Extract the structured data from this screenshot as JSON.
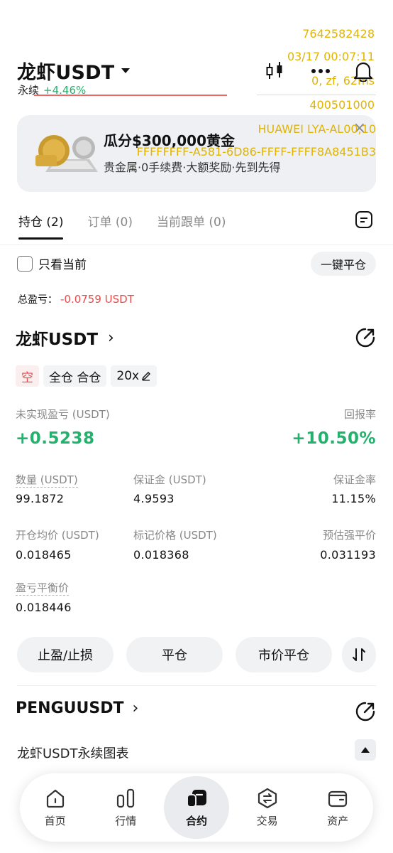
{
  "debug": {
    "line1": "7642582428",
    "line2": "03/17 00:07:11",
    "line3": "0, zf, 62ms",
    "line4": "400501000",
    "line5": "HUAWEI LYA-AL00,10",
    "line6": "FFFFFFFF-A581-6D86-FFFF-FFFF8A8451B3"
  },
  "header": {
    "title": "龙虾USDT",
    "subtitle_prefix": "永续",
    "change": "+4.46%",
    "icons": [
      "candlestick-icon",
      "more-icon",
      "bell-icon"
    ]
  },
  "banner": {
    "title": "瓜分$300,000黄金",
    "subtitle": "贵金属·0手续费·大额奖励·先到先得",
    "close": "×"
  },
  "tabs": [
    {
      "label": "持仓 (2)",
      "active": true
    },
    {
      "label": "订单 (0)",
      "active": false
    },
    {
      "label": "当前跟单 (0)",
      "active": false
    }
  ],
  "filter": {
    "checkbox_label": "只看当前",
    "close_all": "一键平仓"
  },
  "total_pnl": {
    "label": "总盈亏：",
    "value": "-0.0759 USDT"
  },
  "position": {
    "symbol": "龙虾USDT",
    "tags": [
      "空",
      "全仓 合仓",
      "20x"
    ],
    "unrealized_label": "未实现盈亏 (USDT)",
    "unrealized_value": "+0.5238",
    "roe_label": "回报率",
    "roe_value": "+10.50%",
    "qty_label": "数量 (USDT)",
    "qty_value": "99.1872",
    "margin_label": "保证金 (USDT)",
    "margin_value": "4.9593",
    "margin_ratio_label": "保证金率",
    "margin_ratio_value": "11.15%",
    "entry_label": "开仓均价 (USDT)",
    "entry_value": "0.018465",
    "mark_label": "标记价格 (USDT)",
    "mark_value": "0.018368",
    "liq_label": "预估强平价",
    "liq_value": "0.031193",
    "breakeven_label": "盈亏平衡价",
    "breakeven_value": "0.018446"
  },
  "actions": {
    "tp_sl": "止盈/止损",
    "close": "平仓",
    "market_close": "市价平仓"
  },
  "second_position": {
    "symbol": "PENGUUSDT"
  },
  "chart_row": {
    "label": "龙虾USDT永续图表"
  },
  "nav": [
    {
      "label": "首页",
      "icon": "home-icon"
    },
    {
      "label": "行情",
      "icon": "market-icon"
    },
    {
      "label": "合约",
      "icon": "futures-icon",
      "active": true
    },
    {
      "label": "交易",
      "icon": "trade-icon"
    },
    {
      "label": "资产",
      "icon": "wallet-icon"
    }
  ],
  "colors": {
    "green": "#23b26d",
    "red": "#e94b4b",
    "debug_yellow": "#e0b400"
  }
}
